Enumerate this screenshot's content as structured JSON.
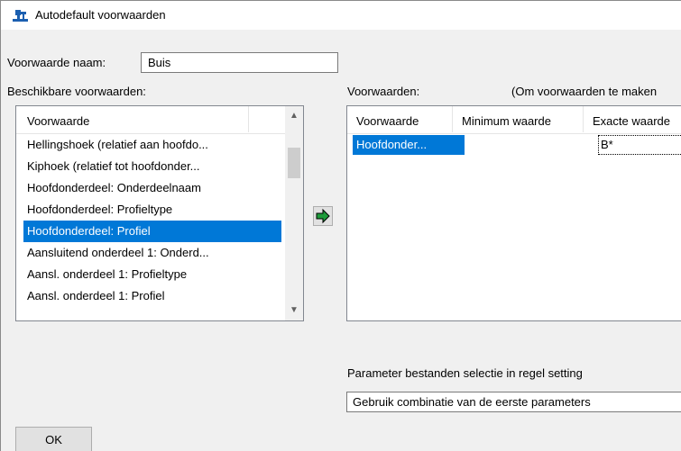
{
  "window": {
    "title": "Autodefault voorwaarden",
    "icon": "tekla-app-icon"
  },
  "name_field": {
    "label": "Voorwaarde naam:",
    "value": "Buis"
  },
  "available": {
    "label": "Beschikbare voorwaarden:",
    "column_header": "Voorwaarde",
    "items": [
      "Hellingshoek (relatief aan hoofdo...",
      "Kiphoek (relatief tot hoofdonder...",
      "Hoofdonderdeel: Onderdeelnaam",
      "Hoofdonderdeel: Profieltype",
      "Hoofdonderdeel: Profiel",
      "Aansluitend onderdeel 1: Onderd...",
      "Aansl. onderdeel 1: Profieltype",
      "Aansl. onderdeel 1: Profiel"
    ],
    "selected_index": 4
  },
  "add_button": {
    "icon": "arrow-right-icon"
  },
  "conditions": {
    "label": "Voorwaarden:",
    "hint": "(Om voorwaarden te maken",
    "columns": [
      "Voorwaarde",
      "Minimum waarde",
      "Exacte waarde"
    ],
    "rows": [
      {
        "voorwaarde": "Hoofdonder...",
        "minimum": "",
        "exact": "B*"
      }
    ]
  },
  "parameter_selection": {
    "label": "Parameter bestanden selectie in regel setting",
    "value": "Gebruik combinatie van de eerste parameters"
  },
  "ok_button": {
    "label": "OK"
  },
  "colors": {
    "selection": "#0078d7",
    "window_bg": "#f0f0f0",
    "arrow_green": "#1e9a3a"
  }
}
